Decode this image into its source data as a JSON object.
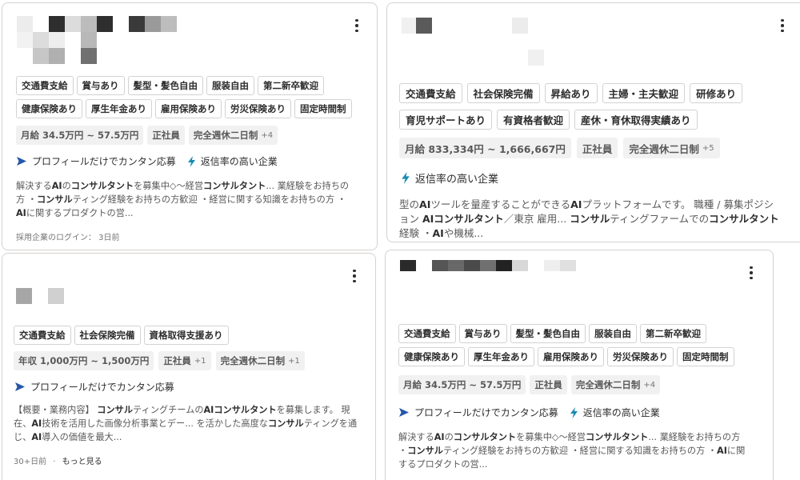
{
  "cards": [
    {
      "tags": [
        "交通費支給",
        "賞与あり",
        "髪型・髪色自由",
        "服装自由",
        "第二新卒歓迎",
        "健康保険あり",
        "厚生年金あり",
        "雇用保険あり",
        "労災保険あり",
        "固定時間制"
      ],
      "meta": [
        {
          "label": "月給 34.5万円 ~ 57.5万円",
          "plus": ""
        },
        {
          "label": "正社員",
          "plus": ""
        },
        {
          "label": "完全週休二日制",
          "plus": "+4"
        }
      ],
      "features": [
        "プロフィールだけでカンタン応募",
        "返信率の高い企業"
      ],
      "snippet": [
        {
          "t": "解決する"
        },
        {
          "t": "AI",
          "b": true
        },
        {
          "t": "の"
        },
        {
          "t": "コンサルタント",
          "b": true
        },
        {
          "t": "を募集中◇～経営"
        },
        {
          "t": "コンサルタント",
          "b": true
        },
        {
          "t": "... 業経験をお持ちの方 ・"
        },
        {
          "t": "コンサル",
          "b": true
        },
        {
          "t": "ティング経験をお持ちの方歓迎 ・経営に関する知識をお持ちの方 ・"
        },
        {
          "t": "AI",
          "b": true
        },
        {
          "t": "に関するプロダクトの営..."
        }
      ],
      "footer": "採用企業のログイン： 3日前"
    },
    {
      "tags": [
        "交通費支給",
        "社会保険完備",
        "昇給あり",
        "主婦・主夫歓迎",
        "研修あり",
        "育児サポートあり",
        "有資格者歓迎",
        "産休・育休取得実績あり"
      ],
      "meta": [
        {
          "label": "月給 833,334円 ~ 1,666,667円",
          "plus": ""
        },
        {
          "label": "正社員",
          "plus": ""
        },
        {
          "label": "完全週休二日制",
          "plus": "+5"
        }
      ],
      "features": [
        "返信率の高い企業"
      ],
      "snippet": [
        {
          "t": "型の"
        },
        {
          "t": "AI",
          "b": true
        },
        {
          "t": "ツールを量産することができる"
        },
        {
          "t": "AI",
          "b": true
        },
        {
          "t": "プラットフォームです。 職種 / 募集ポジション "
        },
        {
          "t": "AIコンサルタント",
          "b": true
        },
        {
          "t": "／東京 雇用... "
        },
        {
          "t": "コンサル",
          "b": true
        },
        {
          "t": "ティングファームでの"
        },
        {
          "t": "コンサルタント",
          "b": true
        },
        {
          "t": "経験 ・"
        },
        {
          "t": "AI",
          "b": true
        },
        {
          "t": "や機械..."
        }
      ]
    },
    {
      "tags": [
        "交通費支給",
        "社会保険完備",
        "資格取得支援あり"
      ],
      "meta": [
        {
          "label": "年収 1,000万円 ~ 1,500万円",
          "plus": ""
        },
        {
          "label": "正社員",
          "plus": "+1"
        },
        {
          "label": "完全週休二日制",
          "plus": "+1"
        }
      ],
      "features": [
        "プロフィールだけでカンタン応募"
      ],
      "snippet": [
        {
          "t": "【概要・業務内容】 "
        },
        {
          "t": "コンサル",
          "b": true
        },
        {
          "t": "ティングチームの"
        },
        {
          "t": "AIコンサルタント",
          "b": true
        },
        {
          "t": "を募集します。 現在、"
        },
        {
          "t": "AI",
          "b": true
        },
        {
          "t": "技術を活用した画像分析事業とデー... を活かした高度な"
        },
        {
          "t": "コンサル",
          "b": true
        },
        {
          "t": "ティングを通じ、"
        },
        {
          "t": "AI",
          "b": true
        },
        {
          "t": "導入の価値を最大..."
        }
      ],
      "footer": "30+日前",
      "footer_more": "もっと見る"
    },
    {
      "tags": [
        "交通費支給",
        "賞与あり",
        "髪型・髪色自由",
        "服装自由",
        "第二新卒歓迎",
        "健康保険あり",
        "厚生年金あり",
        "雇用保険あり",
        "労災保険あり",
        "固定時間制"
      ],
      "meta": [
        {
          "label": "月給 34.5万円 ~ 57.5万円",
          "plus": ""
        },
        {
          "label": "正社員",
          "plus": ""
        },
        {
          "label": "完全週休二日制",
          "plus": "+4"
        }
      ],
      "features": [
        "プロフィールだけでカンタン応募",
        "返信率の高い企業"
      ],
      "snippet": [
        {
          "t": "解決する"
        },
        {
          "t": "AI",
          "b": true
        },
        {
          "t": "の"
        },
        {
          "t": "コンサルタント",
          "b": true
        },
        {
          "t": "を募集中◇～経営"
        },
        {
          "t": "コンサルタント",
          "b": true
        },
        {
          "t": "... 業経験をお持ちの方 ・"
        },
        {
          "t": "コンサル",
          "b": true
        },
        {
          "t": "ティング経験をお持ちの方歓迎 ・経営に関する知識をお持ちの方 ・"
        },
        {
          "t": "AI",
          "b": true
        },
        {
          "t": "に関するプロダクトの営..."
        }
      ]
    }
  ],
  "icons": {
    "more": "kebab-menu-icon",
    "apply": "arrow-send-icon",
    "response": "lightning-icon"
  },
  "colors": {
    "apply_icon": "#2557a7",
    "response_icon": "#1a8cb0",
    "tag_border": "#d4d2d0",
    "chip_bg": "#f1f1f1"
  }
}
